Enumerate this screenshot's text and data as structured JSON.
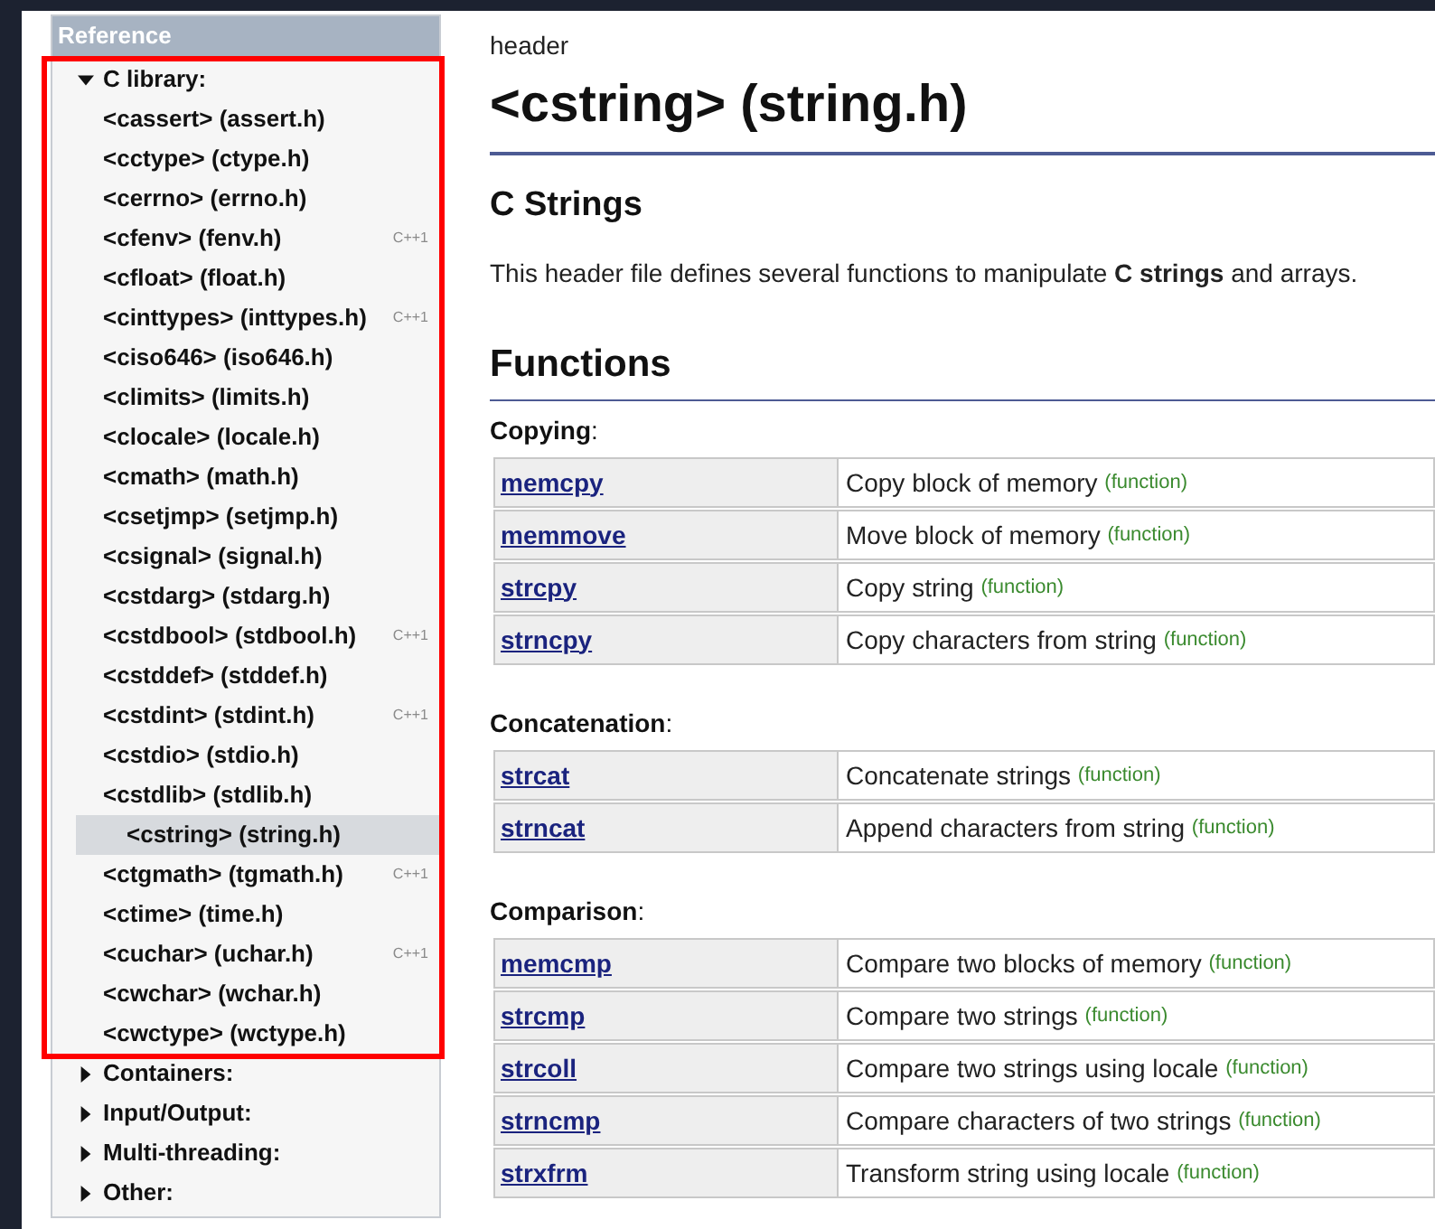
{
  "sidebar": {
    "title": "Reference",
    "sections": [
      {
        "label": "C library:",
        "expanded": true,
        "children": [
          {
            "label": "<cassert> (assert.h)",
            "selected": false
          },
          {
            "label": "<cctype> (ctype.h)",
            "selected": false
          },
          {
            "label": "<cerrno> (errno.h)",
            "selected": false
          },
          {
            "label": "<cfenv> (fenv.h)",
            "tag": "C++1",
            "selected": false
          },
          {
            "label": "<cfloat> (float.h)",
            "selected": false
          },
          {
            "label": "<cinttypes> (inttypes.h)",
            "tag": "C++1",
            "selected": false
          },
          {
            "label": "<ciso646> (iso646.h)",
            "selected": false
          },
          {
            "label": "<climits> (limits.h)",
            "selected": false
          },
          {
            "label": "<clocale> (locale.h)",
            "selected": false
          },
          {
            "label": "<cmath> (math.h)",
            "selected": false
          },
          {
            "label": "<csetjmp> (setjmp.h)",
            "selected": false
          },
          {
            "label": "<csignal> (signal.h)",
            "selected": false
          },
          {
            "label": "<cstdarg> (stdarg.h)",
            "selected": false
          },
          {
            "label": "<cstdbool> (stdbool.h)",
            "tag": "C++1",
            "selected": false
          },
          {
            "label": "<cstddef> (stddef.h)",
            "selected": false
          },
          {
            "label": "<cstdint> (stdint.h)",
            "tag": "C++1",
            "selected": false
          },
          {
            "label": "<cstdio> (stdio.h)",
            "selected": false
          },
          {
            "label": "<cstdlib> (stdlib.h)",
            "selected": false
          },
          {
            "label": "<cstring> (string.h)",
            "selected": true
          },
          {
            "label": "<ctgmath> (tgmath.h)",
            "tag": "C++1",
            "selected": false
          },
          {
            "label": "<ctime> (time.h)",
            "selected": false
          },
          {
            "label": "<cuchar> (uchar.h)",
            "tag": "C++1",
            "selected": false
          },
          {
            "label": "<cwchar> (wchar.h)",
            "selected": false
          },
          {
            "label": "<cwctype> (wctype.h)",
            "selected": false
          }
        ]
      },
      {
        "label": "Containers:",
        "expanded": false
      },
      {
        "label": "Input/Output:",
        "expanded": false
      },
      {
        "label": "Multi-threading:",
        "expanded": false
      },
      {
        "label": "Other:",
        "expanded": false
      }
    ]
  },
  "main": {
    "kicker": "header",
    "title": "<cstring> (string.h)",
    "section_title": "C Strings",
    "description": "This header file defines several functions to manipulate **C strings** and arrays.",
    "functions_heading": "Functions",
    "groups": [
      {
        "label": "**Copying**:",
        "rows": [
          {
            "name": "memcpy",
            "description": "Copy block of memory",
            "note": "(function)"
          },
          {
            "name": "memmove",
            "description": "Move block of memory",
            "note": "(function)"
          },
          {
            "name": "strcpy",
            "description": "Copy string",
            "note": "(function)"
          },
          {
            "name": "strncpy",
            "description": "Copy characters from string",
            "note": "(function)"
          }
        ]
      },
      {
        "label": "**Concatenation**:",
        "rows": [
          {
            "name": "strcat",
            "description": "Concatenate strings",
            "note": "(function)"
          },
          {
            "name": "strncat",
            "description": "Append characters from string",
            "note": "(function)"
          }
        ]
      },
      {
        "label": "**Comparison**:",
        "rows": [
          {
            "name": "memcmp",
            "description": "Compare two blocks of memory",
            "note": "(function)"
          },
          {
            "name": "strcmp",
            "description": "Compare two strings",
            "note": "(function)"
          },
          {
            "name": "strcoll",
            "description": "Compare two strings using locale",
            "note": "(function)"
          },
          {
            "name": "strncmp",
            "description": "Compare characters of two strings",
            "note": "(function)"
          },
          {
            "name": "strxfrm",
            "description": "Transform string using locale",
            "note": "(function)"
          }
        ]
      }
    ]
  }
}
